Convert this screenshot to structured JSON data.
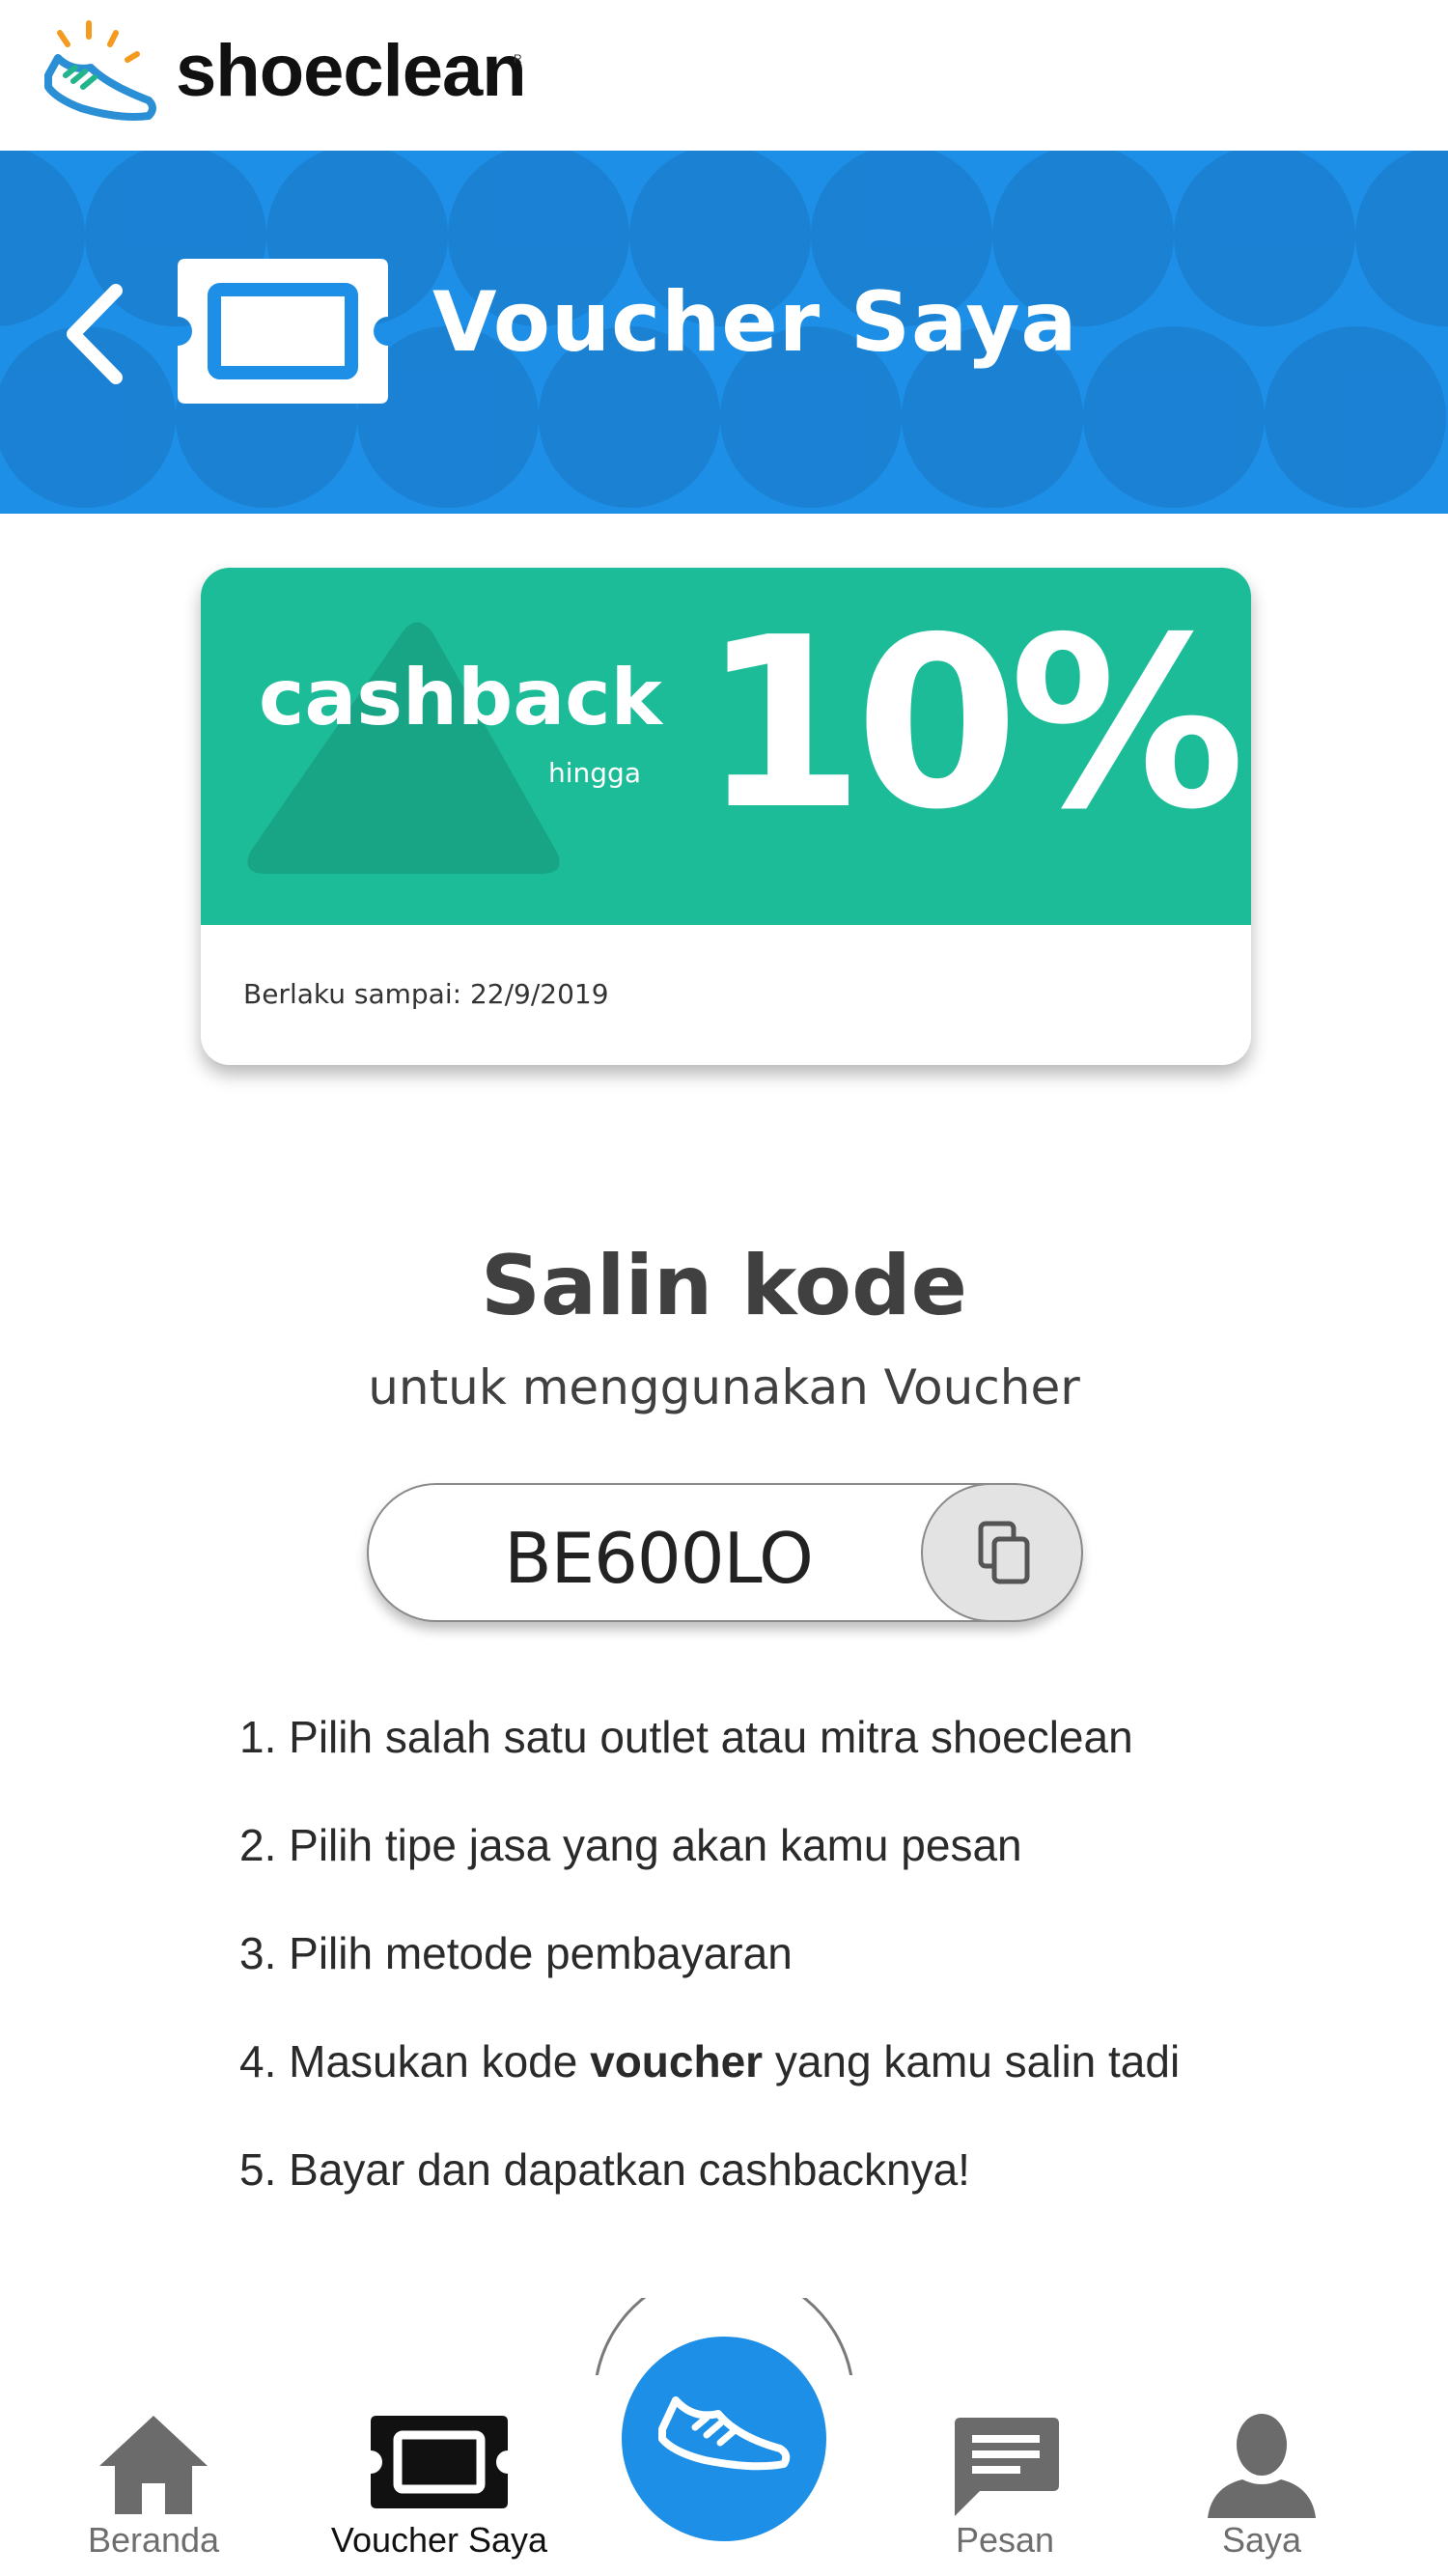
{
  "brand": {
    "name": "shoeclean",
    "registered_mark": "R"
  },
  "header": {
    "title": "Voucher Saya",
    "back_icon": "chevron-left-icon",
    "title_icon": "ticket-icon",
    "color": "#1e8fe6"
  },
  "voucher": {
    "label": "cashback",
    "qualifier": "hingga",
    "value": "10%",
    "valid_until": "Berlaku sampai: 22/9/2019",
    "color": "#1dbc98"
  },
  "copy_section": {
    "title": "Salin kode",
    "subtitle": "untuk menggunakan Voucher",
    "code": "BE600LO",
    "copy_icon": "copy-icon"
  },
  "steps": [
    {
      "text": "1. Pilih salah satu outlet atau mitra shoeclean"
    },
    {
      "text": "2. Pilih tipe jasa yang akan kamu pesan"
    },
    {
      "text": "3. Pilih metode pembayaran"
    },
    {
      "prefix": "4. Masukan kode ",
      "bold": "voucher",
      "suffix": " yang kamu salin tadi"
    },
    {
      "text": "5. Bayar dan dapatkan cashbacknya!"
    }
  ],
  "nav": {
    "items": [
      {
        "label": "Beranda",
        "icon": "home-icon"
      },
      {
        "label": "Voucher Saya",
        "icon": "ticket-icon",
        "active": true
      },
      {
        "label": "Pesan",
        "icon": "chat-icon"
      },
      {
        "label": "Saya",
        "icon": "person-icon"
      }
    ],
    "center_icon": "shoe-icon",
    "center_color": "#1e8fe6"
  }
}
